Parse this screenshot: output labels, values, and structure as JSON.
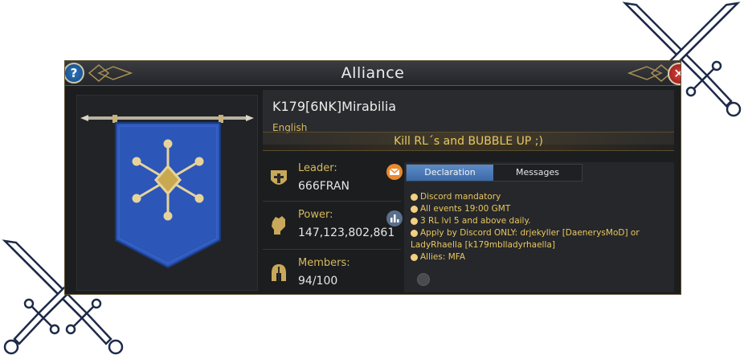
{
  "window": {
    "title": "Alliance",
    "help_label": "?",
    "close_label": "✕"
  },
  "alliance": {
    "name": "K179[6NK]Mirabilia",
    "language": "English",
    "motto": "Kill RL´s and BUBBLE UP ;)"
  },
  "stats": {
    "leader": {
      "label": "Leader:",
      "value": "666FRAN",
      "icon": "helmet-shield-icon",
      "action_icon": "mail-icon"
    },
    "power": {
      "label": "Power:",
      "value": "147,123,802,861",
      "icon": "fist-icon",
      "action_icon": "bar-chart-icon"
    },
    "members": {
      "label": "Members:",
      "value": "94/100",
      "icon": "helmet-icon"
    }
  },
  "tabs": {
    "declaration": "Declaration",
    "messages": "Messages",
    "active": "Declaration"
  },
  "declaration": [
    "Discord mandatory",
    "All events 19:00 GMT",
    "3 RL lvl 5 and above daily.",
    "Apply by Discord ONLY: drjekyller [DaenerysMoD] or",
    "LadyRhaella [k179mblladyrhaella]",
    "Allies: MFA"
  ],
  "colors": {
    "accent_gold": "#e8c760",
    "banner_blue": "#2c56b8",
    "tab_active": "#4a78b6"
  }
}
